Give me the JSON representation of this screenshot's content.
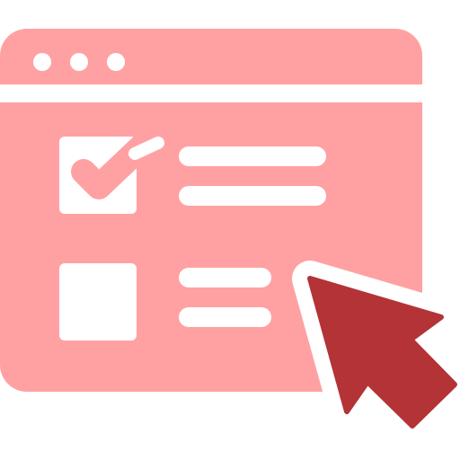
{
  "icon": {
    "name": "checklist-survey-with-cursor-icon",
    "colors": {
      "window": "#ffa1a2",
      "cutout": "#ffffff",
      "cursor": "#b33336"
    },
    "window_controls": [
      "dot",
      "dot",
      "dot"
    ],
    "checklist": {
      "items": [
        {
          "checked": true,
          "text_lines": 2
        },
        {
          "checked": false,
          "text_lines": 2
        }
      ]
    },
    "cursor": "arrow-cursor-icon"
  }
}
